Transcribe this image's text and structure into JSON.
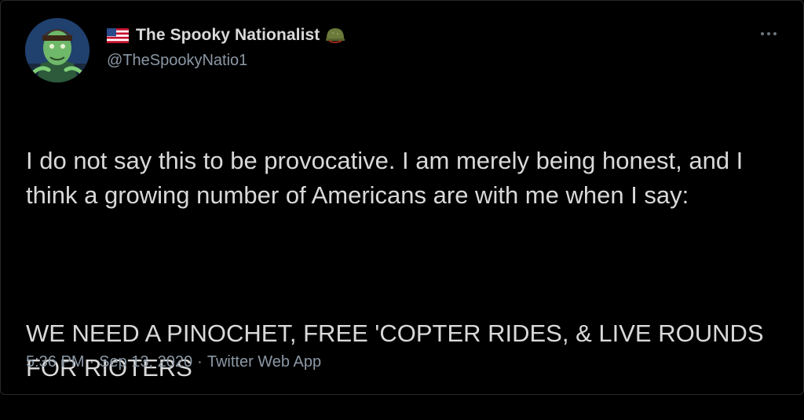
{
  "tweet": {
    "display_name": "The Spooky Nationalist",
    "handle": "@TheSpookyNatio1",
    "name_flag_icon": "us-flag-icon",
    "name_badge_icon": "army-helmet-icon",
    "paragraphs": [
      "I do not say this to be provocative. I am merely being honest, and I think a growing number of Americans are with me when I say:",
      "WE NEED A PINOCHET, FREE 'COPTER RIDES, & LIVE ROUNDS FOR RIOTERS"
    ],
    "time": "5:36 PM",
    "date": "Sep 13, 2020",
    "source": "Twitter Web App",
    "separator": "·"
  },
  "colors": {
    "background": "#000000",
    "text": "#d9d9d9",
    "secondary": "#8b98a5"
  }
}
